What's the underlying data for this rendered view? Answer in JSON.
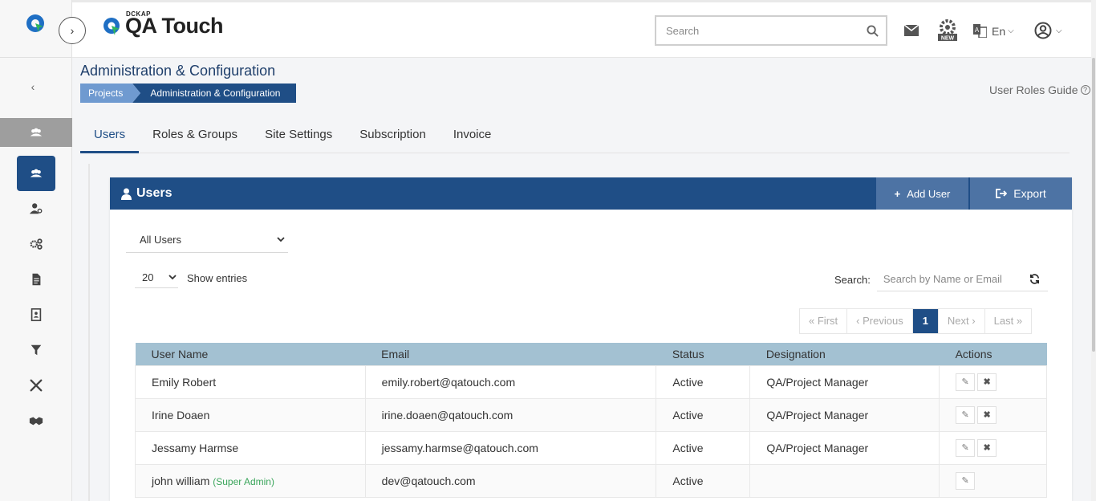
{
  "header": {
    "brand_small": "DCKAP",
    "brand_name": "QA Touch",
    "search_placeholder": "Search",
    "language": "En"
  },
  "page": {
    "title": "Administration & Configuration",
    "breadcrumb": [
      "Projects",
      "Administration & Configuration"
    ],
    "guide_label": "User Roles Guide"
  },
  "tabs": [
    {
      "label": "Users",
      "active": true
    },
    {
      "label": "Roles & Groups",
      "active": false
    },
    {
      "label": "Site Settings",
      "active": false
    },
    {
      "label": "Subscription",
      "active": false
    },
    {
      "label": "Invoice",
      "active": false
    }
  ],
  "panel": {
    "title": "Users",
    "add_label": "Add User",
    "export_label": "Export",
    "filter_value": "All Users",
    "entries_value": "20",
    "entries_label": "Show entries",
    "search_label": "Search:",
    "search_placeholder": "Search by Name or Email"
  },
  "pagination": {
    "first": "First",
    "previous": "Previous",
    "current": "1",
    "next": "Next",
    "last": "Last"
  },
  "table": {
    "columns": [
      "User Name",
      "Email",
      "Status",
      "Designation",
      "Actions"
    ],
    "rows": [
      {
        "name": "Emily Robert",
        "tag": "",
        "email": "emily.robert@qatouch.com",
        "status": "Active",
        "designation": "QA/Project Manager"
      },
      {
        "name": "Irine Doaen",
        "tag": "",
        "email": "irine.doaen@qatouch.com",
        "status": "Active",
        "designation": "QA/Project Manager"
      },
      {
        "name": "Jessamy Harmse",
        "tag": "",
        "email": "jessamy.harmse@qatouch.com",
        "status": "Active",
        "designation": "QA/Project Manager"
      },
      {
        "name": "john william",
        "tag": "(Super Admin)",
        "email": "dev@qatouch.com",
        "status": "Active",
        "designation": ""
      }
    ]
  },
  "colors": {
    "primary": "#1f4e86",
    "breadcrumb_light": "#6f9ad0",
    "table_header": "#a3c1d2",
    "admin_tag": "#3aa55b"
  },
  "icons": {
    "rail": [
      "users-group-icon",
      "users-group-icon",
      "user-settings-icon",
      "gears-icon",
      "document-icon",
      "address-book-icon",
      "filter-icon",
      "tools-icon",
      "handshake-icon"
    ]
  }
}
